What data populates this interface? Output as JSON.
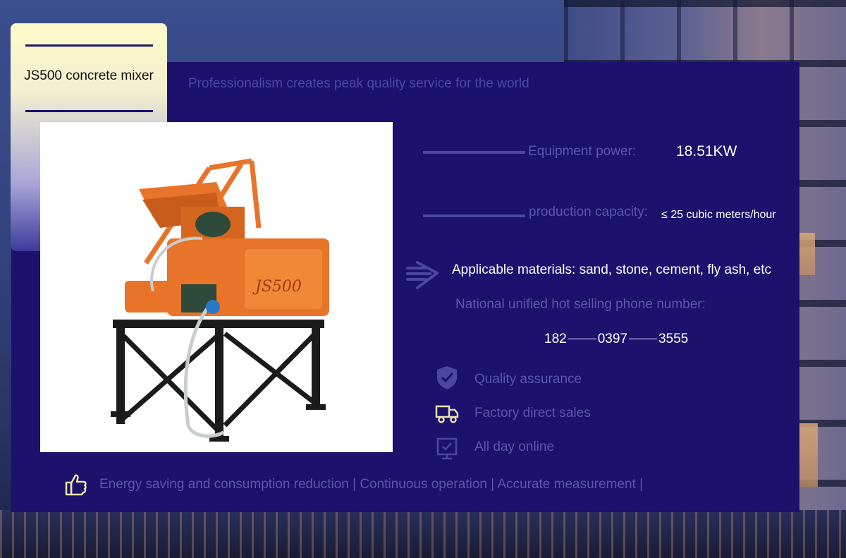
{
  "title": "JS500 concrete mixer",
  "tagline": "Professionalism creates peak quality service for the world",
  "specs": {
    "power_label": "Equipment power:",
    "power_value": "18.51KW",
    "capacity_label": "production capacity:",
    "capacity_value": "≤ 25 cubic meters/hour"
  },
  "materials": "Applicable materials: sand, stone, cement, fly ash, etc",
  "phone_label": "National unified hot selling phone number:",
  "phone": {
    "part1": "182",
    "part2": "0397",
    "part3": "3555"
  },
  "features": [
    {
      "icon": "shield-check-icon",
      "label": "Quality assurance"
    },
    {
      "icon": "truck-icon",
      "label": "Factory direct sales"
    },
    {
      "icon": "monitor-check-icon",
      "label": "All day online"
    }
  ],
  "bottom_text": "Energy saving and consumption reduction | Continuous operation | Accurate measurement |",
  "mixer_label": "JS500",
  "colors": {
    "panel": "#1c116d",
    "accent_text": "#5a55b0",
    "machine": "#e8742a"
  }
}
